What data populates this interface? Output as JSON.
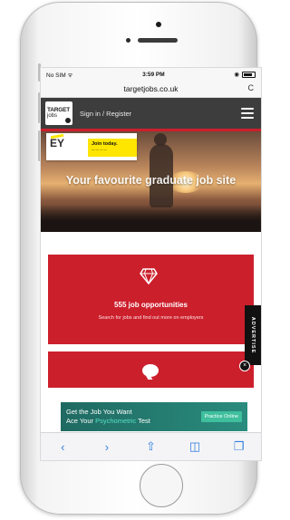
{
  "status_bar": {
    "carrier": "No SIM",
    "time": "3:59 PM"
  },
  "browser": {
    "url": "targetjobs.co.uk",
    "reload_glyph": "C"
  },
  "site_nav": {
    "logo_line1": "TARGET",
    "logo_line2": "jobs",
    "signin_label": "Sign in / Register"
  },
  "hero": {
    "ad_brand": "EY",
    "ad_cta": "Join today.",
    "headline": "Your favourite graduate job site"
  },
  "cards": [
    {
      "icon": "diamond-icon",
      "title": "555 job opportunities",
      "subtitle": "Search for jobs and find out more on employers"
    },
    {
      "icon": "speech-bubble-icon"
    }
  ],
  "advertise_tab": {
    "label": "ADVERTISE",
    "close_glyph": "×"
  },
  "banner": {
    "line1": "Get the Job You Want",
    "line2_prefix": "Ace Your ",
    "line2_highlight": "Psychometric",
    "line2_suffix": " Test",
    "cta": "Practice Online"
  },
  "toolbar": {
    "back": "‹",
    "forward": "›",
    "share": "⇧",
    "bookmarks": "◫",
    "tabs": "❐"
  },
  "colors": {
    "brand_red": "#cc1f2c",
    "nav_dark": "#3d3d3d",
    "ios_blue": "#2f7de1",
    "banner_teal": "#2a8c7e"
  }
}
